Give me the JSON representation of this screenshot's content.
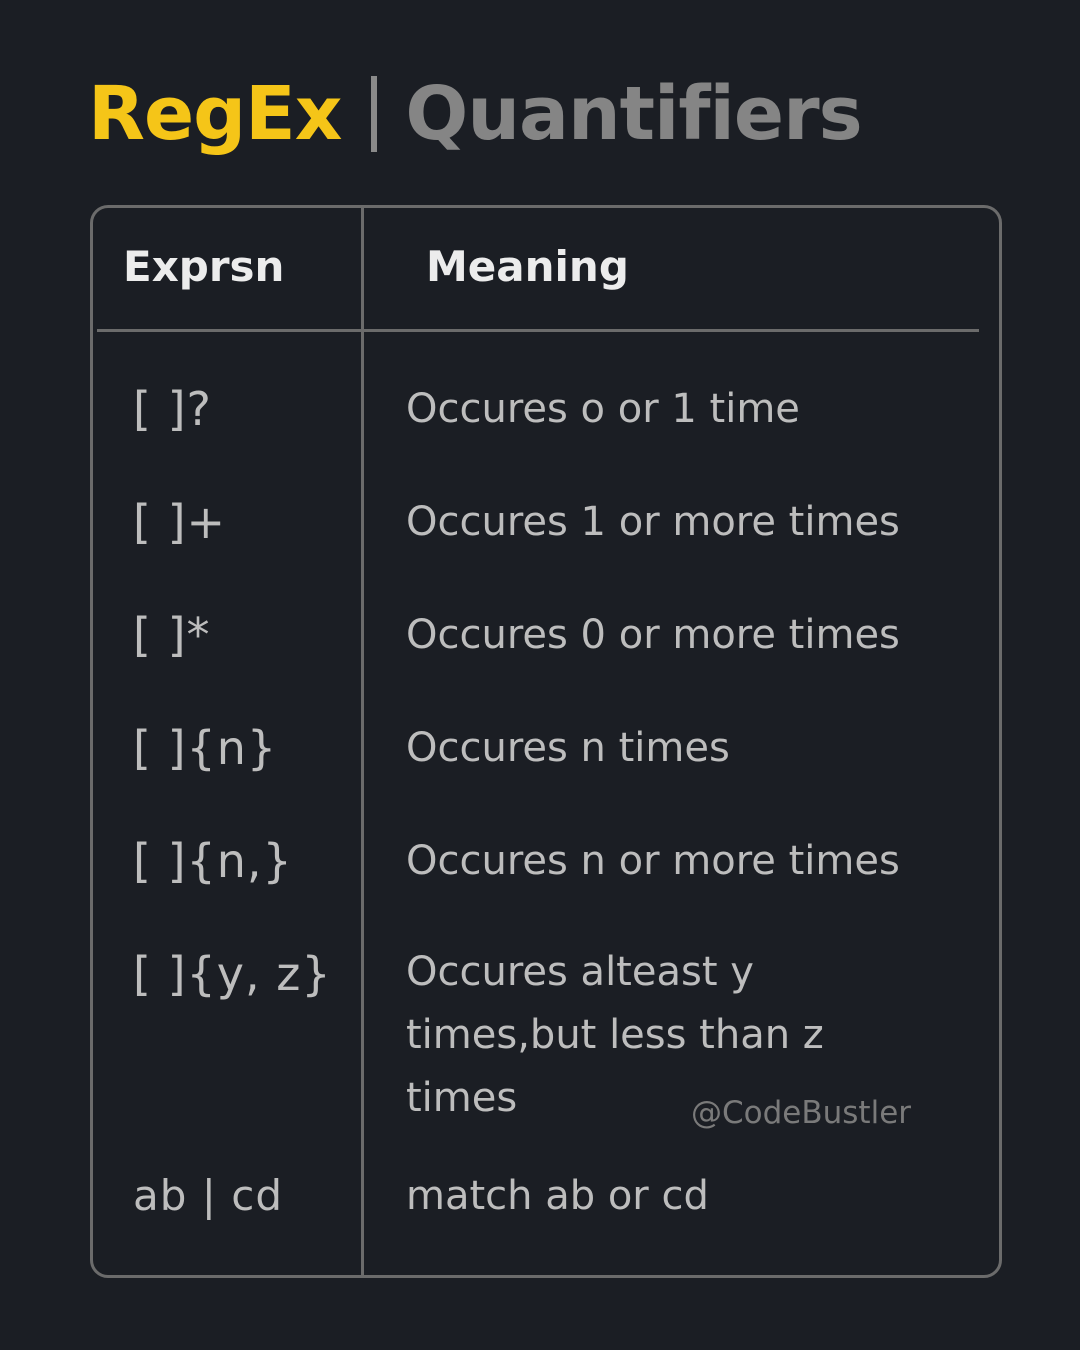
{
  "title": {
    "brand": "RegEx",
    "separator": "|",
    "topic": "Quantifiers"
  },
  "colors": {
    "background": "#1b1e24",
    "brand": "#f5c518",
    "topic": "#858585",
    "border": "#6b6b6b",
    "text": "#bdbdbd",
    "header": "#ececec"
  },
  "table": {
    "headers": {
      "expression": "Exprsn",
      "meaning": "Meaning"
    },
    "rows": [
      {
        "expression": "[ ]?",
        "meaning": "Occures o or 1 time"
      },
      {
        "expression": "[ ]+",
        "meaning": "Occures 1 or more times"
      },
      {
        "expression": "[ ]*",
        "meaning": "Occures 0 or more times"
      },
      {
        "expression": "[ ]{n}",
        "meaning": "Occures n times"
      },
      {
        "expression": "[ ]{n,}",
        "meaning": "Occures n or more times"
      },
      {
        "expression": "[ ]{y, z}",
        "meaning": "Occures alteast y times,but less than z times"
      },
      {
        "expression": "ab | cd",
        "meaning": "match ab or cd"
      }
    ]
  },
  "watermark": "@CodeBustler"
}
